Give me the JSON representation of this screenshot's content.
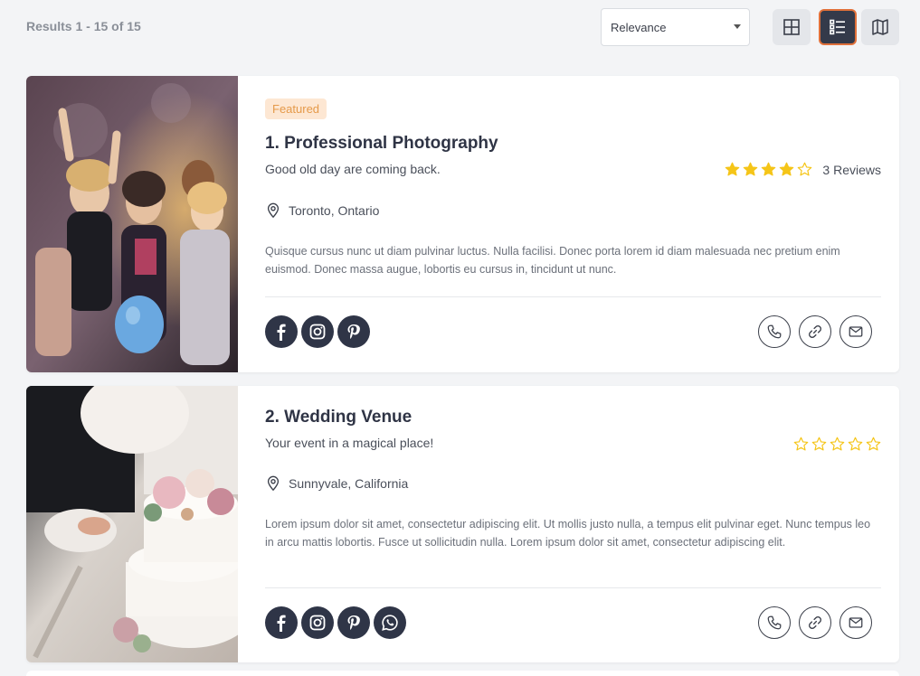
{
  "toolbar": {
    "results_text": "Results 1 - 15 of 15",
    "sort_value": "Relevance",
    "views": [
      {
        "icon": "grid-view-icon",
        "active": false
      },
      {
        "icon": "list-view-icon",
        "active": true
      },
      {
        "icon": "map-view-icon",
        "active": false
      }
    ]
  },
  "listings": [
    {
      "badge": "Featured",
      "title": "1. Professional Photography",
      "tagline": "Good old day are coming back.",
      "rating": 4,
      "max_rating": 5,
      "reviews_text": "3 Reviews",
      "location": "Toronto, Ontario",
      "description": "Quisque cursus nunc ut diam pulvinar luctus. Nulla facilisi. Donec porta lorem id diam malesuada nec pretium enim euismod. Donec massa augue, lobortis eu cursus in, tincidunt ut nunc.",
      "socials": [
        "facebook-icon",
        "instagram-icon",
        "pinterest-icon"
      ],
      "image": "party-photo"
    },
    {
      "title": "2. Wedding Venue",
      "tagline": "Your event in a magical place!",
      "rating": 0,
      "max_rating": 5,
      "location": "Sunnyvale, California",
      "description": "Lorem ipsum dolor sit amet, consectetur adipiscing elit. Ut mollis justo nulla, a tempus elit pulvinar eget. Nunc tempus leo in arcu mattis lobortis. Fusce ut sollicitudin nulla. Lorem ipsum dolor sit amet, consectetur adipiscing elit.",
      "socials": [
        "facebook-icon",
        "instagram-icon",
        "pinterest-icon",
        "whatsapp-icon"
      ],
      "image": "wedding-cake-photo"
    }
  ],
  "actions": [
    "phone-icon",
    "link-icon",
    "mail-icon"
  ],
  "colors": {
    "accent": "#e0703a",
    "dark": "#2f3547",
    "star": "#f5c518",
    "badge_bg": "#fde7d3",
    "badge_text": "#e59a4a"
  }
}
